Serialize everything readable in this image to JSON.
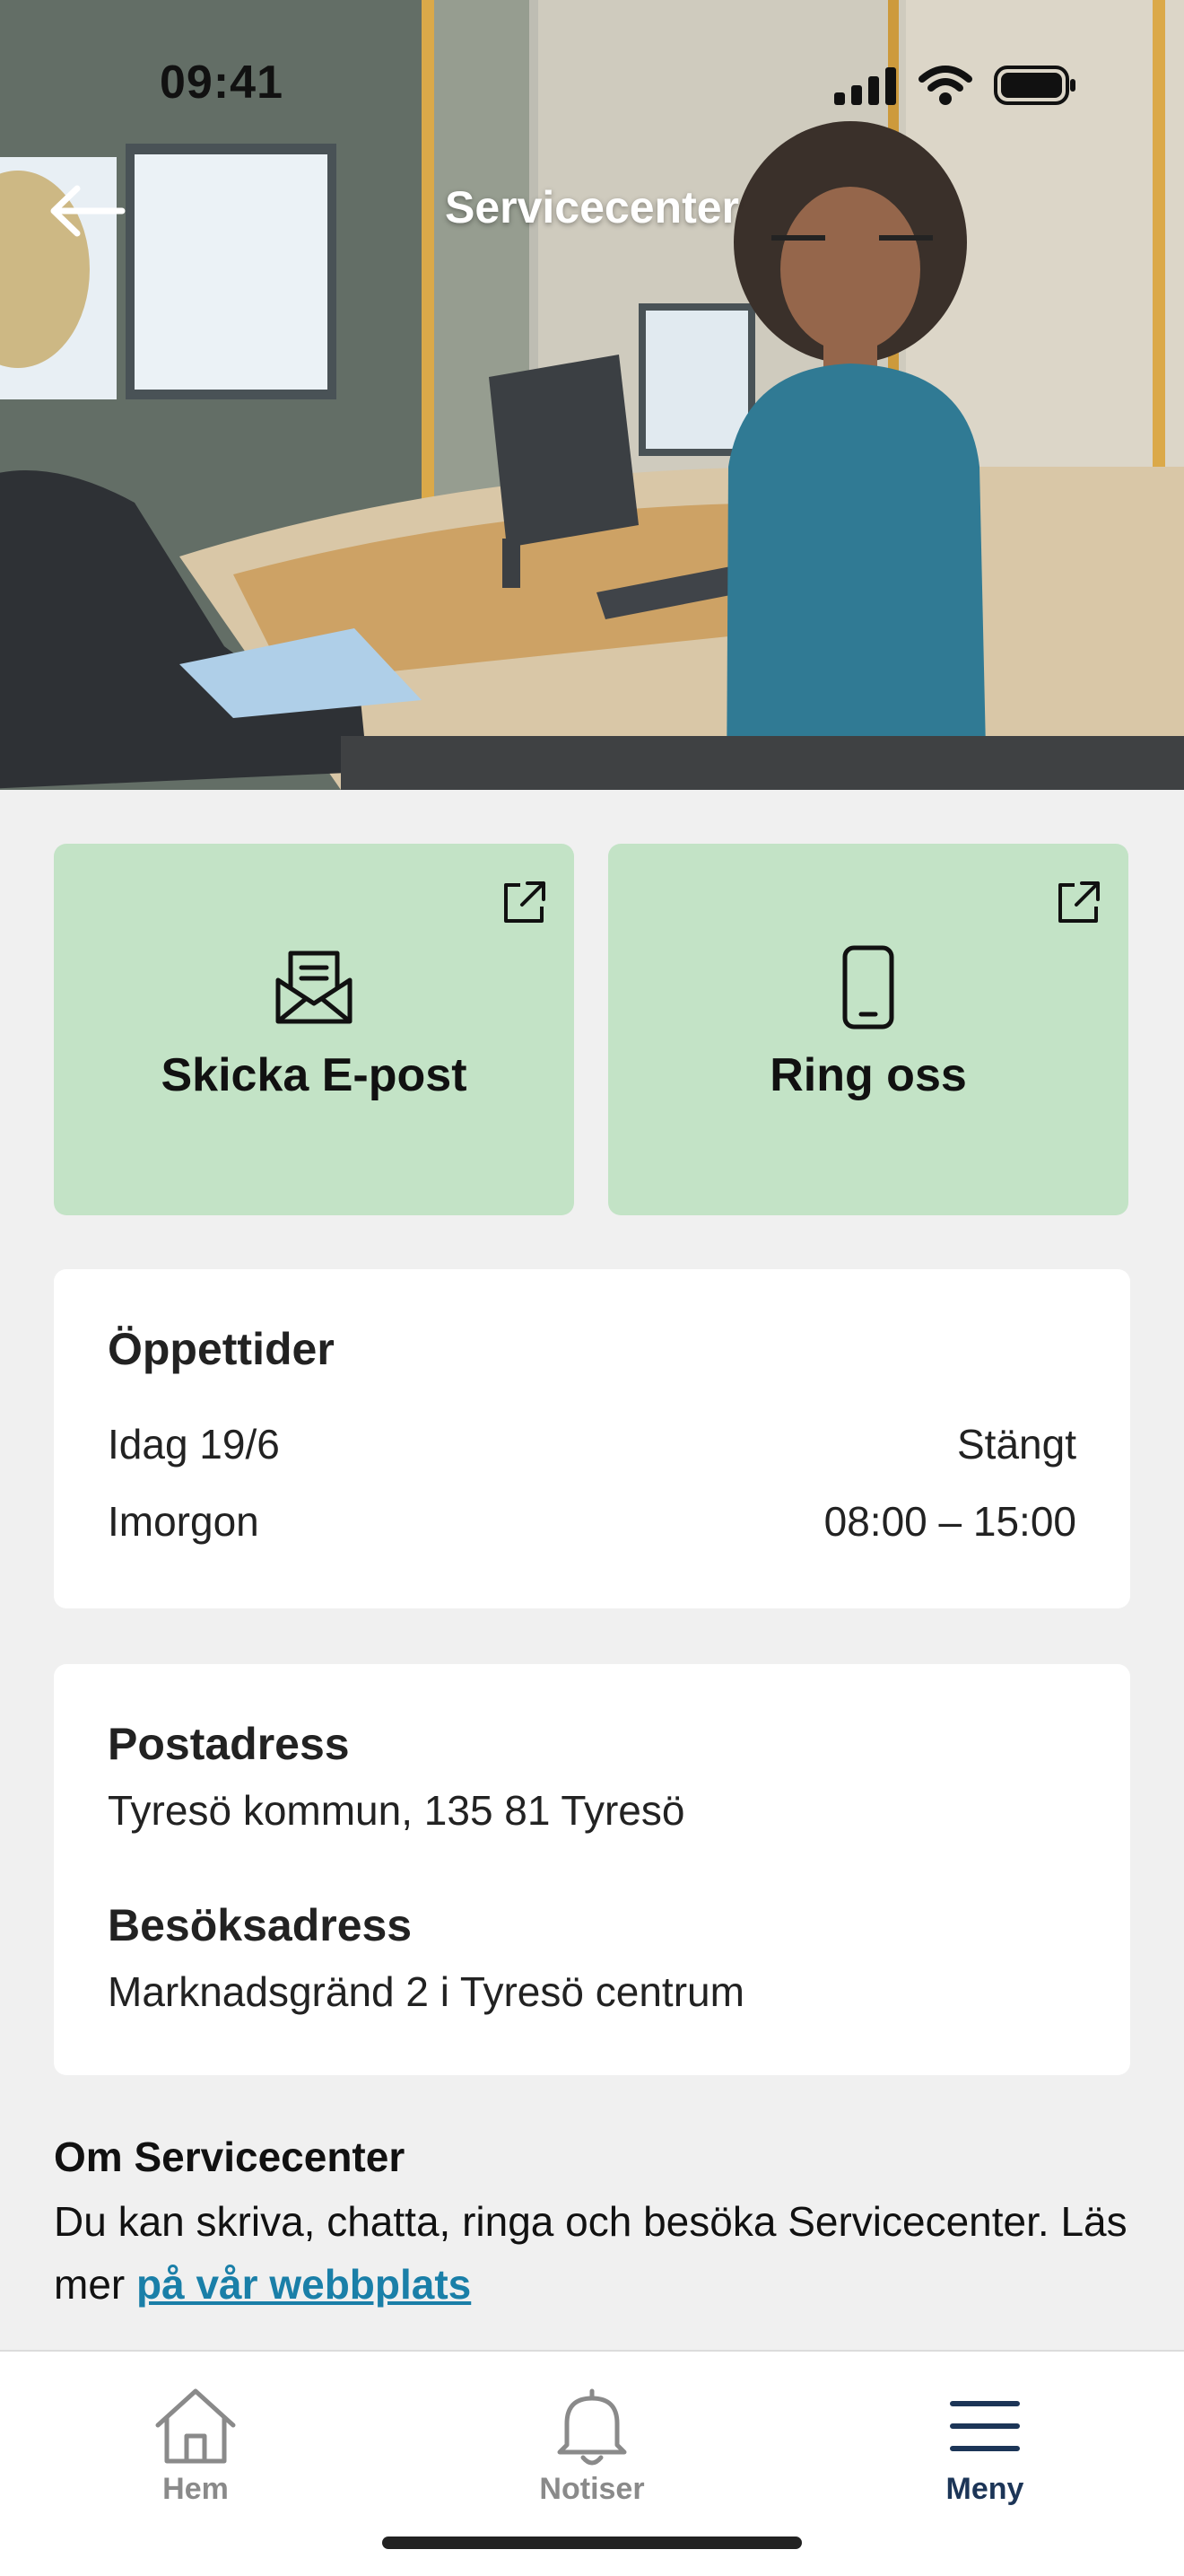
{
  "status_bar": {
    "time": "09:41"
  },
  "nav": {
    "title": "Servicecenter",
    "back_icon": "arrow-left-icon"
  },
  "actions": [
    {
      "label": "Skicka E-post",
      "icon": "envelope-icon",
      "badge_icon": "external-link-icon"
    },
    {
      "label": "Ring oss",
      "icon": "phone-icon",
      "badge_icon": "external-link-icon"
    }
  ],
  "hours": {
    "heading": "Öppettider",
    "rows": [
      {
        "day": "Idag 19/6",
        "time": "Stängt"
      },
      {
        "day": "Imorgon",
        "time": "08:00 – 15:00"
      }
    ]
  },
  "addresses": {
    "postal_heading": "Postadress",
    "postal_value": "Tyresö kommun, 135 81 Tyresö",
    "visit_heading": "Besöksadress",
    "visit_value": "Marknadsgränd 2 i Tyresö centrum"
  },
  "about": {
    "title": "Om Servicecenter",
    "text": "Du kan skriva, chatta, ringa och besöka Servicecenter. Läs mer",
    "link": "på vår webbplats"
  },
  "tabbar": {
    "items": [
      {
        "label": "Hem",
        "icon": "home-icon",
        "active": false
      },
      {
        "label": "Notiser",
        "icon": "bell-icon",
        "active": false
      },
      {
        "label": "Meny",
        "icon": "hamburger-menu-icon",
        "active": true
      }
    ]
  },
  "colors": {
    "action_card_bg": "#c3e3c6",
    "link": "#1a7fa8",
    "active_tab": "#1c3557",
    "inactive_tab": "#8a8a8a"
  }
}
